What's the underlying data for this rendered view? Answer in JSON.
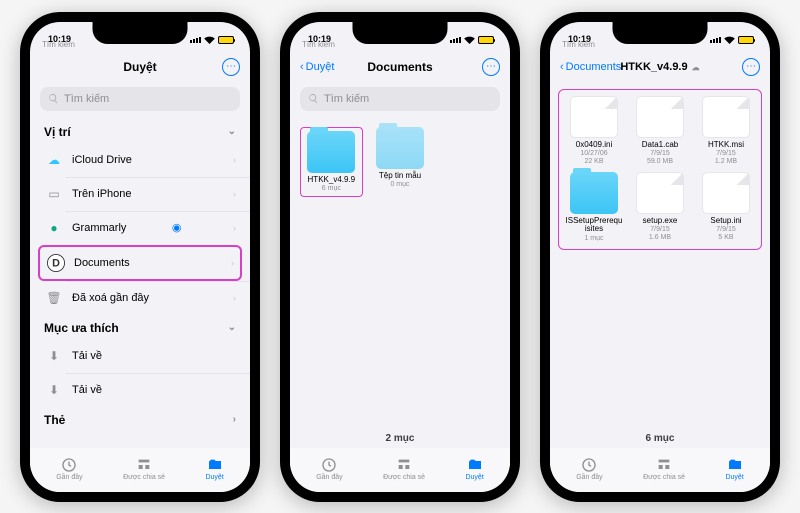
{
  "status": {
    "time": "10:19",
    "carrier_sub": "Tìm kiếm"
  },
  "toolbar": {
    "recents": "Gần đây",
    "shared": "Được chia sẻ",
    "browse": "Duyệt"
  },
  "screen1": {
    "title": "Duyệt",
    "search_placeholder": "Tìm kiếm",
    "section_locations": "Vị trí",
    "section_favorites": "Mục ưa thích",
    "section_tags": "Thẻ",
    "items": {
      "icloud": "iCloud Drive",
      "iphone": "Trên iPhone",
      "grammarly": "Grammarly",
      "documents": "Documents",
      "deleted": "Đã xoá gần đây"
    },
    "fav": {
      "downloads": "Tải về",
      "downloads2": "Tải về"
    }
  },
  "screen2": {
    "back": "Duyệt",
    "title": "Documents",
    "search_placeholder": "Tìm kiếm",
    "folders": [
      {
        "name": "HTKK_v4.9.9",
        "meta": "6 mục"
      },
      {
        "name": "Tệp tin mẫu",
        "meta": "0 mục"
      }
    ],
    "count": "2 mục"
  },
  "screen3": {
    "back": "Documents",
    "title": "HTKK_v4.9.9",
    "files": [
      {
        "type": "file",
        "name": "0x0409.ini",
        "date": "10/27/06",
        "size": "22 KB"
      },
      {
        "type": "file",
        "name": "Data1.cab",
        "date": "7/9/15",
        "size": "59.0 MB"
      },
      {
        "type": "file",
        "name": "HTKK.msi",
        "date": "7/9/15",
        "size": "1.2 MB"
      },
      {
        "type": "folder",
        "name": "ISSetupPrerequisites",
        "date": "",
        "size": "1 mục"
      },
      {
        "type": "file",
        "name": "setup.exe",
        "date": "7/9/15",
        "size": "1.6 MB"
      },
      {
        "type": "file",
        "name": "Setup.ini",
        "date": "7/9/15",
        "size": "5 KB"
      }
    ],
    "count": "6 mục"
  }
}
